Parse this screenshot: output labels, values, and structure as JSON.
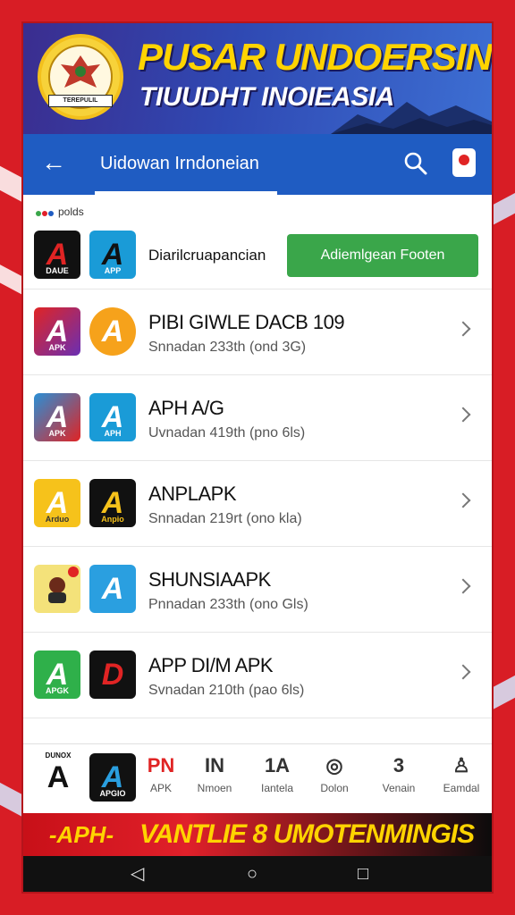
{
  "banner": {
    "title": "PUSAR UNDOERSIN",
    "subtitle": "TIUUDHT INOIEASIA",
    "emblem_text": "TEREPULIL"
  },
  "appbar": {
    "title": "Uidowan Irndoneian"
  },
  "section_tag": "polds",
  "feature": {
    "label": "Diarilcruapancian",
    "cta": "Adiemlgean Footen",
    "icon1_text": "DAUE",
    "icon2_text": "APP"
  },
  "apps": [
    {
      "title": "PIBI GIWLE DACB 109",
      "sub": "Snnadan 233th (ond 3G)",
      "icon1": "APK",
      "icon2": ""
    },
    {
      "title": "APH A/G",
      "sub": "Uvnadan 419th (pno 6ls)",
      "icon1": "APK",
      "icon2": "APH"
    },
    {
      "title": "ANPLAPK",
      "sub": "Snnadan 219rt (ono kla)",
      "icon1": "Arduo",
      "icon2": "Anpio"
    },
    {
      "title": "SHUNSIAAPK",
      "sub": "Pnnadan 233th (ono Gls)",
      "icon1": "",
      "icon2": ""
    },
    {
      "title": "APP DI/M APK",
      "sub": "Svnadan 210th (pao 6ls)",
      "icon1": "APGK",
      "icon2": ""
    }
  ],
  "bottomnav": {
    "brand_top": "DUNOX",
    "brand_icon_text": "APGIO",
    "items": [
      {
        "glyph": "PN",
        "label": "APK"
      },
      {
        "glyph": "IN",
        "label": "Nmoen"
      },
      {
        "glyph": "1A",
        "label": "Iantela"
      },
      {
        "glyph": "◎",
        "label": "Dolon"
      },
      {
        "glyph": "3",
        "label": "Venain"
      },
      {
        "glyph": "♙",
        "label": "Eamdal"
      }
    ]
  },
  "promo": {
    "left": "-APH-",
    "right": "VANTLIE 8 UMOTENMINGIS"
  },
  "sysnav": {
    "back": "◁",
    "home": "○",
    "recents": "□"
  },
  "colors": {
    "background": "#d81d25",
    "appbar": "#1f5cc2",
    "cta": "#3aa64a",
    "banner_title": "#ffd400"
  }
}
